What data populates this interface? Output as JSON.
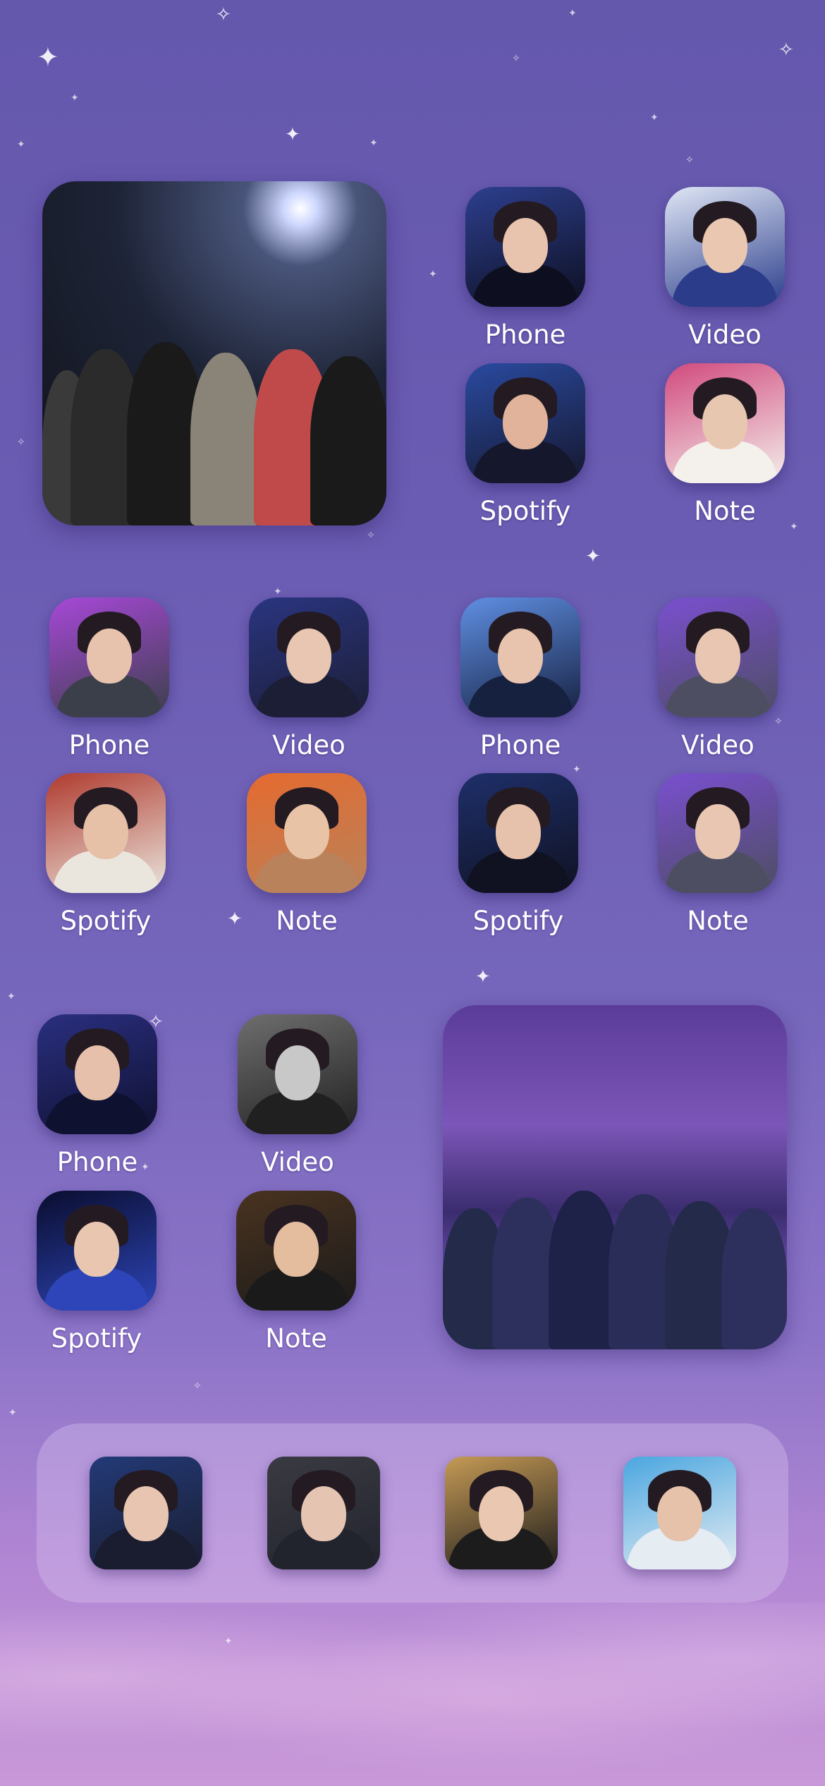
{
  "screen": {
    "apps": [
      {
        "label": "Phone",
        "icon": "photo-app-icon",
        "colors": [
          "#2d3f8f",
          "#0d0f20",
          "#e8c3ad"
        ]
      },
      {
        "label": "Video",
        "icon": "photo-app-icon",
        "colors": [
          "#dfe6f5",
          "#2a3c8a",
          "#e9c7b0"
        ]
      },
      {
        "label": "Spotify",
        "icon": "photo-app-icon",
        "colors": [
          "#2a4aa0",
          "#15172d",
          "#e0b39a"
        ]
      },
      {
        "label": "Note",
        "icon": "photo-app-icon",
        "colors": [
          "#d14a7e",
          "#f4f0ec",
          "#e8c7b0"
        ]
      },
      {
        "label": "Phone",
        "icon": "photo-app-icon",
        "colors": [
          "#a748d8",
          "#3b3f4a",
          "#e7c2ad"
        ]
      },
      {
        "label": "Video",
        "icon": "photo-app-icon",
        "colors": [
          "#2a3580",
          "#1c1e36",
          "#e8c6b2"
        ]
      },
      {
        "label": "Phone",
        "icon": "photo-app-icon",
        "colors": [
          "#5f8fe3",
          "#16203f",
          "#e8c3ad"
        ]
      },
      {
        "label": "Video",
        "icon": "photo-app-icon",
        "colors": [
          "#7a4fd0",
          "#4d4e62",
          "#e8c6b2"
        ]
      },
      {
        "label": "Spotify",
        "icon": "photo-app-icon",
        "colors": [
          "#b03a2e",
          "#eae6de",
          "#e7c0a8"
        ]
      },
      {
        "label": "Note",
        "icon": "photo-app-icon",
        "colors": [
          "#e56a2f",
          "#b9825a",
          "#e9c3a5"
        ]
      },
      {
        "label": "Spotify",
        "icon": "photo-app-icon",
        "colors": [
          "#1e2f6a",
          "#101222",
          "#e6c1ab"
        ]
      },
      {
        "label": "Note",
        "icon": "photo-app-icon",
        "colors": [
          "#7a4fd0",
          "#4d4e62",
          "#e8c6b2"
        ]
      },
      {
        "label": "Phone",
        "icon": "photo-app-icon",
        "colors": [
          "#2a2f80",
          "#0f1130",
          "#e6c0aa"
        ]
      },
      {
        "label": "Video",
        "icon": "photo-app-icon",
        "colors": [
          "#6e6e6e",
          "#202020",
          "#c8c8c8"
        ]
      },
      {
        "label": "Spotify",
        "icon": "photo-app-icon",
        "colors": [
          "#0a0d2e",
          "#2d45b8",
          "#e8c6b0"
        ]
      },
      {
        "label": "Note",
        "icon": "photo-app-icon",
        "colors": [
          "#4a3320",
          "#1a1a1a",
          "#e4bc9e"
        ]
      }
    ],
    "widgets": [
      {
        "name": "group-photo-widget-night",
        "colors": [
          "#1e2437",
          "#2a2a2a",
          "#8a8377",
          "#c04a4a",
          "#1a1a1a"
        ]
      },
      {
        "name": "group-photo-widget-stage",
        "colors": [
          "#4a2f86",
          "#232a4a",
          "#e06ab0",
          "#2d2f5c",
          "#d7c7ef"
        ]
      }
    ]
  },
  "dock": {
    "apps": [
      {
        "icon": "photo-app-icon",
        "colors": [
          "#233a78",
          "#1a1d30",
          "#e8c5b1"
        ]
      },
      {
        "icon": "photo-app-icon",
        "colors": [
          "#3a3a42",
          "#22242d",
          "#e6c4b2"
        ]
      },
      {
        "icon": "photo-app-icon",
        "colors": [
          "#c59a55",
          "#1c1c1c",
          "#e9c7b0"
        ]
      },
      {
        "icon": "photo-app-icon",
        "colors": [
          "#4aa6e0",
          "#e5ecf2",
          "#e6c2ab"
        ]
      }
    ]
  },
  "theme": {
    "accent": "#6a5cb2",
    "label_color": "#ffffff"
  }
}
